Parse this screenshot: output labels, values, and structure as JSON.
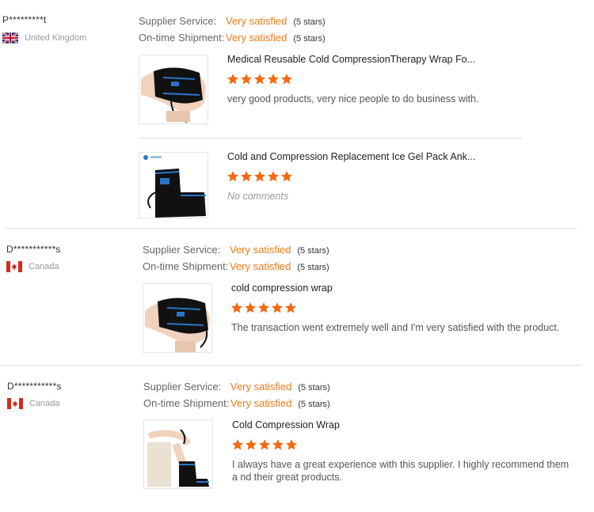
{
  "colors": {
    "accent": "#f07a17",
    "star": "#f46a0f",
    "divider": "#dddddd"
  },
  "reviews": [
    {
      "user": "P*********t",
      "country": "United Kingdom",
      "flag": "uk-flag-icon",
      "supplier_label": "Supplier Service:",
      "supplier_value": "Very satisfied",
      "supplier_stars": "(5 stars)",
      "shipment_label": "On-time Shipment:",
      "shipment_value": "Very satisfied",
      "shipment_stars": "(5 stars)",
      "products": [
        {
          "title": "Medical Reusable Cold CompressionTherapy Wrap Fo...",
          "rating": 5,
          "comment": "very good products, very nice people to do business with."
        },
        {
          "title": "Cold and Compression Replacement Ice Gel Pack Ank...",
          "rating": 5,
          "comment": "No comments"
        }
      ]
    },
    {
      "user": "D***********s",
      "country": "Canada",
      "flag": "canada-flag-icon",
      "supplier_label": "Supplier Service:",
      "supplier_value": "Very satisfied",
      "supplier_stars": "(5 stars)",
      "shipment_label": "On-time Shipment:",
      "shipment_value": "Very satisfied",
      "shipment_stars": "(5 stars)",
      "products": [
        {
          "title": "cold compression wrap",
          "rating": 5,
          "comment": "The transaction went extremely well and I'm very satisfied with the product."
        }
      ]
    },
    {
      "user": "D***********s",
      "country": "Canada",
      "flag": "canada-flag-icon",
      "supplier_label": "Supplier Service:",
      "supplier_value": "Very satisfied",
      "supplier_stars": "(5 stars)",
      "shipment_label": "On-time Shipment:",
      "shipment_value": "Very satisfied",
      "shipment_stars": "(5 stars)",
      "products": [
        {
          "title": "Cold Compression Wrap",
          "rating": 5,
          "comment": "I always have a great experience with this supplier. I highly recommend them a nd their great products."
        }
      ]
    }
  ]
}
